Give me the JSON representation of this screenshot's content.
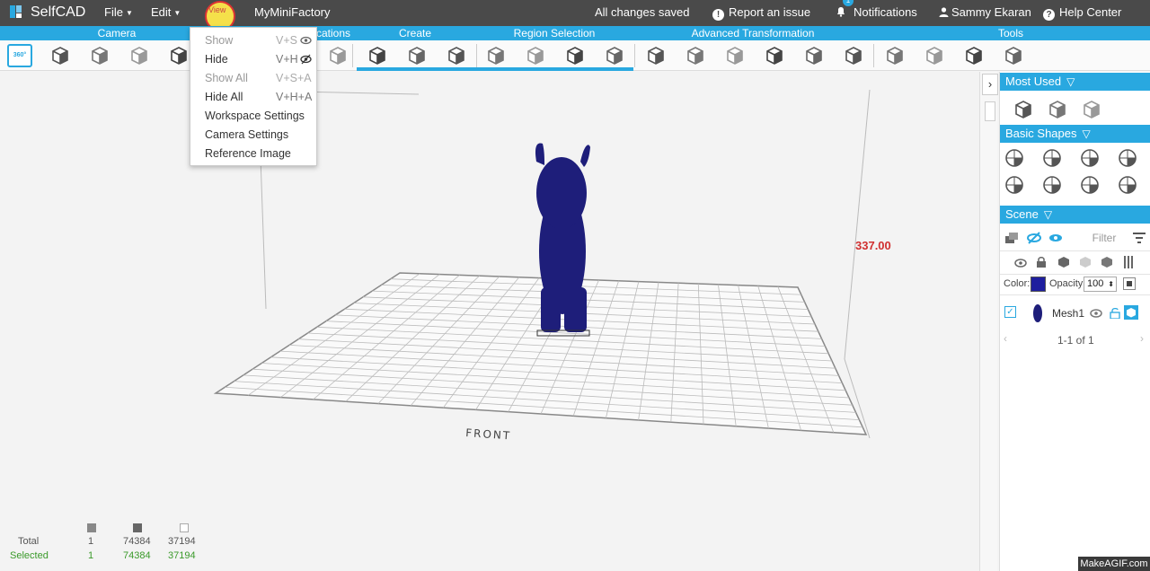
{
  "app": {
    "logo_text": "SelfCAD",
    "menus": [
      {
        "label": "File",
        "has_caret": true
      },
      {
        "label": "Edit",
        "has_caret": true
      },
      {
        "label": "View",
        "has_caret": true
      },
      {
        "label": "MyMiniFactory",
        "has_caret": false
      }
    ],
    "save_status": "All changes saved",
    "report_issue": "Report an issue",
    "notifications": "Notifications",
    "notification_count": "1",
    "user_name": "Sammy Ekaran",
    "help_center": "Help Center"
  },
  "categories": [
    "Camera",
    "Modifications",
    "Create",
    "Region Selection",
    "Advanced Transformation",
    "Tools"
  ],
  "toolbar": {
    "camera_360_label": "360°",
    "tool_icons": [
      "zoom-icon",
      "pan-icon",
      "rotate-icon",
      "settings-icon",
      "mirror-icon",
      "cut-icon",
      "shape-a-icon",
      "shape-b-icon",
      "shape-c-icon",
      "region-a-icon",
      "region-b-icon",
      "region-c-icon",
      "region-d-icon",
      "stack-icon",
      "cube-grid-icon",
      "taper-icon",
      "pyramid-icon",
      "twist-icon",
      "bend-icon",
      "tool-a-icon",
      "tool-b-icon",
      "tool-c-icon",
      "tool-d-icon",
      "tool-e-icon",
      "brush-icon"
    ]
  },
  "view_menu": {
    "items": [
      {
        "label": "Show",
        "shortcut": "V+S",
        "disabled": true,
        "icon": "eye-icon"
      },
      {
        "label": "Hide",
        "shortcut": "V+H",
        "disabled": false,
        "icon": "eye-slash-icon"
      },
      {
        "label": "Show All",
        "shortcut": "V+S+A",
        "disabled": true
      },
      {
        "label": "Hide All",
        "shortcut": "V+H+A",
        "disabled": false
      },
      {
        "label": "Workspace Settings",
        "shortcut": "",
        "disabled": false
      },
      {
        "label": "Camera Settings",
        "shortcut": "",
        "disabled": false
      },
      {
        "label": "Reference Image",
        "shortcut": "",
        "disabled": false
      }
    ]
  },
  "viewport": {
    "dimension_label": "337.00",
    "front_label": "FRONT",
    "model_color": "#1e1e7a"
  },
  "stats": {
    "rows": [
      {
        "label": "Total",
        "objects": "1",
        "faces": "74384",
        "vertices": "37194"
      },
      {
        "label": "Selected",
        "objects": "1",
        "faces": "74384",
        "vertices": "37194"
      }
    ]
  },
  "panel": {
    "most_used_title": "Most Used",
    "basic_shapes_title": "Basic Shapes",
    "scene_title": "Scene",
    "filter_placeholder": "Filter",
    "color_label": "Color:",
    "opacity_label": "Opacity:",
    "opacity_value": "100",
    "color_value": "#1e1e9e",
    "mesh_name": "Mesh1",
    "pagination": "1-1 of 1"
  },
  "watermark": "MakeAGIF.com",
  "colors": {
    "accent": "#29a8e0",
    "topbar": "#4a4a4a",
    "selected_green": "#3a9a2a"
  }
}
